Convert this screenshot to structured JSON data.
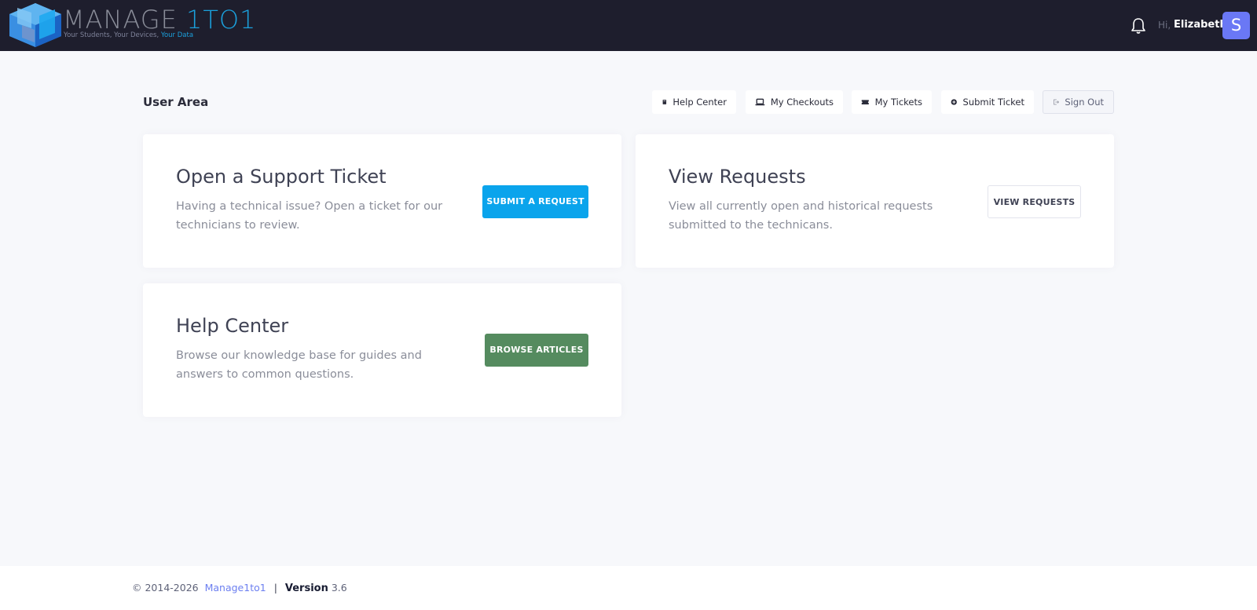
{
  "header": {
    "logo": {
      "title_main": "MANAGE ",
      "title_accent": "1TO1",
      "tagline_main": "Your Students, Your Devices, ",
      "tagline_accent": "Your Data"
    },
    "greeting": "Hi,",
    "user_name": "Elizabeth",
    "avatar_letter": "S",
    "avatar_color": "#6a78f5"
  },
  "toolbar": {
    "page_title": "User Area",
    "buttons": [
      {
        "label": "Help Center",
        "icon": "book-icon"
      },
      {
        "label": "My Checkouts",
        "icon": "laptop-icon"
      },
      {
        "label": "My Tickets",
        "icon": "ticket-icon"
      },
      {
        "label": "Submit Ticket",
        "icon": "plus-circle-icon"
      },
      {
        "label": "Sign Out",
        "icon": "sign-out-icon"
      }
    ]
  },
  "cards": {
    "ticket": {
      "title": "Open a Support Ticket",
      "description": "Having a technical issue? Open a ticket for our technicians to review.",
      "cta": "SUBMIT A REQUEST"
    },
    "requests": {
      "title": "View Requests",
      "description": "View all currently open and historical requests submitted to the technicans.",
      "cta": "VIEW REQUESTS"
    },
    "help": {
      "title": "Help Center",
      "description": "Browse our knowledge base for guides and answers to common questions.",
      "cta": "BROWSE ARTICLES"
    }
  },
  "footer": {
    "copyright": "© 2014-2026",
    "brand": "Manage1to1",
    "separator": "|",
    "version_label": "Version",
    "version_value": "3.6"
  },
  "colors": {
    "header_bg": "#1e1e2d",
    "accent_blue": "#0aa4ec",
    "browse_green": "#558b5f",
    "page_bg": "#f7f8fb"
  }
}
